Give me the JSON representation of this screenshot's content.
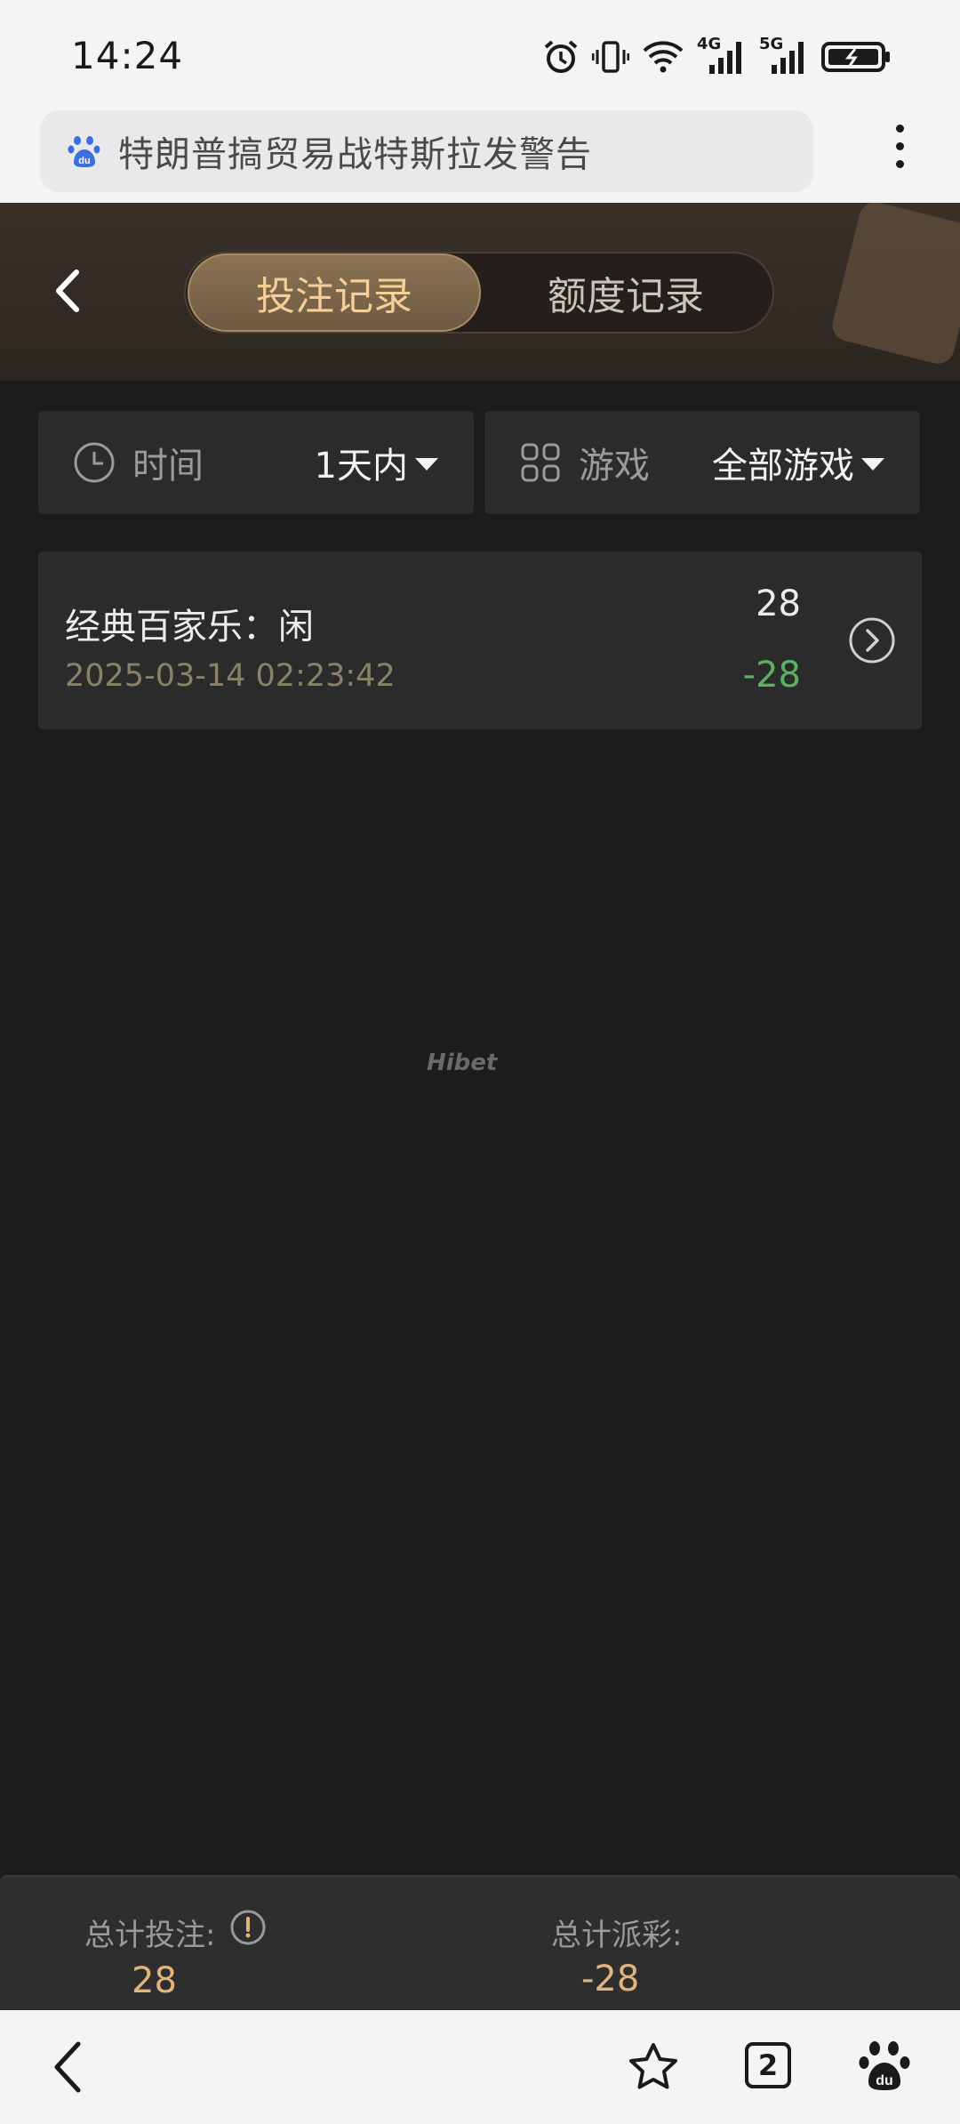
{
  "status_bar": {
    "time": "14:24",
    "net_4g": "4G",
    "net_5g": "5G"
  },
  "browser": {
    "search_text": "特朗普搞贸易战特斯拉发警告",
    "tab_count": "2"
  },
  "header": {
    "tabs": [
      {
        "label": "投注记录",
        "active": true
      },
      {
        "label": "额度记录",
        "active": false
      }
    ]
  },
  "filters": {
    "time": {
      "label": "时间",
      "value": "1天内"
    },
    "game": {
      "label": "游戏",
      "value": "全部游戏"
    }
  },
  "records": [
    {
      "title": "经典百家乐：闲",
      "time": "2025-03-14 02:23:42",
      "bet": "28",
      "payout": "-28"
    }
  ],
  "watermark": "Hibet",
  "totals": {
    "bet_label": "总计投注:",
    "bet_value": "28",
    "payout_label": "总计派彩:",
    "payout_value": "-28"
  },
  "colors": {
    "accent_gold": "#f4cf96",
    "positive_green": "#5bb35f",
    "total_gold": "#e2b37a",
    "background": "#1c1c1c"
  }
}
